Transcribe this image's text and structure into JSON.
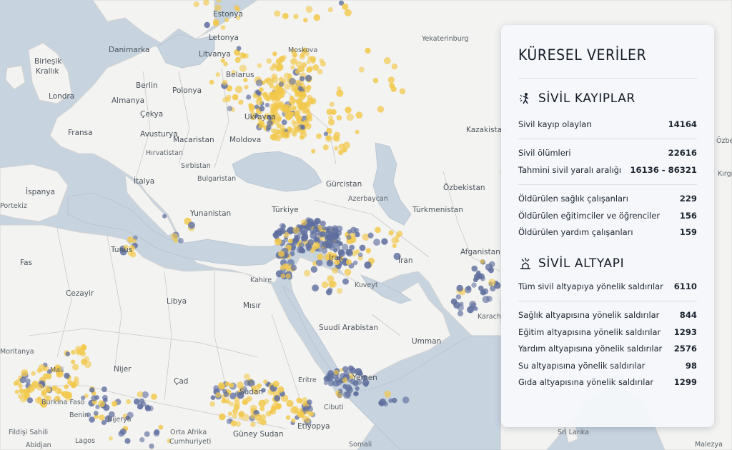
{
  "map_labels": {
    "countries": [
      "Estonya",
      "Letonya",
      "Litvanya",
      "Danimarka",
      "Birleşik Krallık",
      "Belarus",
      "Almanya",
      "Polonya",
      "Londra",
      "Çekya",
      "Ukrayna",
      "Fransa",
      "Avusturya",
      "Macaristan",
      "Moldova",
      "Hırvatistan",
      "Sırbistan",
      "Bulgaristan",
      "İtalya",
      "İspanya",
      "Portekiz",
      "Yunanistan",
      "Türkiye",
      "Gürcistan",
      "Azerbaycan",
      "Türkmenistan",
      "Özbekistan",
      "Kazakistan",
      "Afganistan",
      "Fas",
      "Tunus",
      "Cezayir",
      "Libya",
      "Mısır",
      "Kahire",
      "Irak",
      "İran",
      "Kuveyt",
      "Suudi Arabistan",
      "Umman",
      "Yemen",
      "Eritre",
      "Cibuti",
      "Sudan",
      "Güney Sudan",
      "Etiyopya",
      "Çad",
      "Nijer",
      "Mali",
      "Moritanya",
      "Burkina Faso",
      "Benin",
      "Nijerya",
      "Fildişi Sahili",
      "Abidjan",
      "Lagos",
      "Orta Afrika Cumhuriyeti",
      "Somali",
      "Sri Lanka",
      "Malezya",
      "Moskova",
      "Yekaterinburg",
      "Karachi",
      "Özbekistan",
      "Kırgızistan"
    ]
  },
  "map_points_legend": {
    "civilian_color": "#f2c84b",
    "infrastructure_color": "#5e6e9e"
  },
  "panel": {
    "title": "KÜRESEL VERİLER",
    "sections": [
      {
        "icon": "explosion-person-icon",
        "heading": "SİVİL KAYIPLAR",
        "groups": [
          [
            {
              "label": "Sivil kayıp olayları",
              "value": "14164"
            }
          ],
          [
            {
              "label": "Sivil ölümleri",
              "value": "22616"
            },
            {
              "label": "Tahmini sivil yaralı aralığı",
              "value": "16136 - 86321"
            }
          ],
          [
            {
              "label": "Öldürülen sağlık çalışanları",
              "value": "229"
            },
            {
              "label": "Öldürülen eğitimciler ve öğrenciler",
              "value": "156"
            },
            {
              "label": "Öldürülen yardım çalışanları",
              "value": "159"
            }
          ]
        ]
      },
      {
        "icon": "explosion-building-icon",
        "heading": "SİVİL ALTYAPI",
        "groups": [
          [
            {
              "label": "Tüm sivil altyapıya yönelik saldırılar",
              "value": "6110"
            }
          ],
          [
            {
              "label": "Sağlık altyapısına yönelik saldırılar",
              "value": "844"
            },
            {
              "label": "Eğitim altyapısına yönelik saldırılar",
              "value": "1293"
            },
            {
              "label": "Yardım altyapısına yönelik saldırılar",
              "value": "2576"
            },
            {
              "label": "Su altyapısına yönelik saldırılar",
              "value": "98"
            },
            {
              "label": "Gıda altyapısına yönelik saldırılar",
              "value": "1299"
            }
          ]
        ]
      }
    ]
  }
}
